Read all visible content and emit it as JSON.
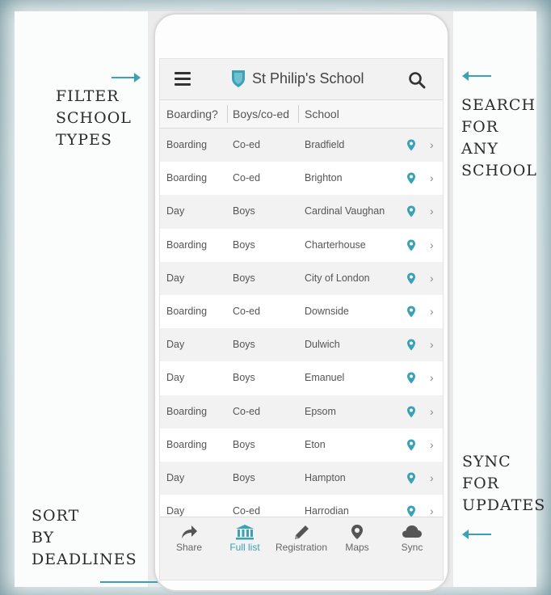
{
  "callouts": {
    "filter": "FILTER\nSCHOOL\nTYPES",
    "search": "SEARCH\nFOR\nANY\nSCHOOL",
    "sync": "SYNC\nFOR\nUPDATES",
    "sort": "SORT\nBY\nDEADLINES"
  },
  "app": {
    "title": "St Philip's School",
    "accent": "#3aa1b6"
  },
  "columns": {
    "boarding": "Boarding?",
    "gender": "Boys/co-ed",
    "school": "School"
  },
  "rows": [
    {
      "type": "Boarding",
      "gender": "Co-ed",
      "school": "Bradfield"
    },
    {
      "type": "Boarding",
      "gender": "Co-ed",
      "school": "Brighton"
    },
    {
      "type": "Day",
      "gender": "Boys",
      "school": "Cardinal Vaughan"
    },
    {
      "type": "Boarding",
      "gender": "Boys",
      "school": "Charterhouse"
    },
    {
      "type": "Day",
      "gender": "Boys",
      "school": "City of London"
    },
    {
      "type": "Boarding",
      "gender": "Co-ed",
      "school": "Downside"
    },
    {
      "type": "Day",
      "gender": "Boys",
      "school": "Dulwich"
    },
    {
      "type": "Day",
      "gender": "Boys",
      "school": "Emanuel"
    },
    {
      "type": "Boarding",
      "gender": "Co-ed",
      "school": "Epsom"
    },
    {
      "type": "Boarding",
      "gender": "Boys",
      "school": "Eton"
    },
    {
      "type": "Day",
      "gender": "Boys",
      "school": "Hampton"
    },
    {
      "type": "Day",
      "gender": "Co-ed",
      "school": "Harrodian"
    }
  ],
  "tabs": {
    "share": "Share",
    "full_list": "Full list",
    "registration": "Registration",
    "maps": "Maps",
    "sync": "Sync"
  }
}
